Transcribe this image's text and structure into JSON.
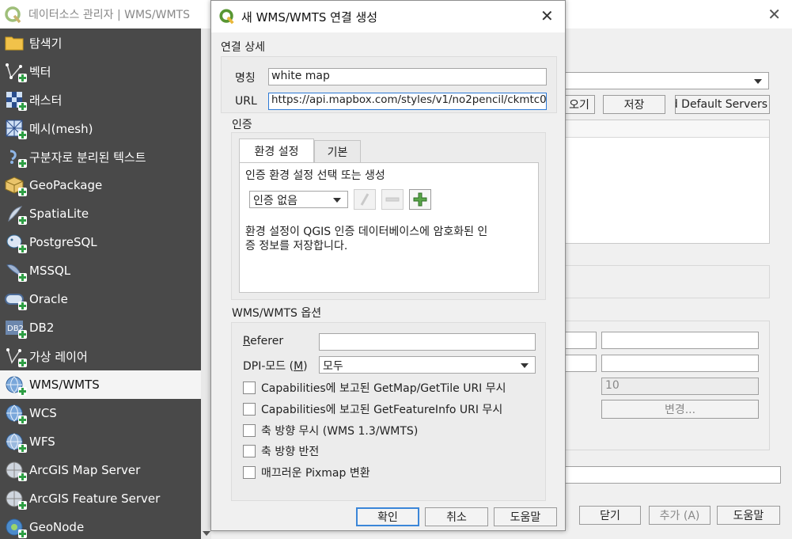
{
  "background_window": {
    "title": "데이터소스 관리자 | WMS/WMTS",
    "buttons": {
      "load_partial": "오기",
      "save": "저장",
      "add_default": "Add Default Servers",
      "close": "닫기",
      "add": "추가 (A)",
      "help": "도움말",
      "change": "변경..."
    },
    "field_values": {
      "tile_size_value": "10"
    }
  },
  "sidebar": {
    "items": [
      {
        "label": "탐색기",
        "icon": "folder-icon"
      },
      {
        "label": "벡터",
        "icon": "vector-layer-icon"
      },
      {
        "label": "래스터",
        "icon": "raster-layer-icon"
      },
      {
        "label": "메시(mesh)",
        "icon": "mesh-layer-icon"
      },
      {
        "label": "구분자로 분리된 텍스트",
        "icon": "delimited-text-icon"
      },
      {
        "label": "GeoPackage",
        "icon": "geopackage-icon"
      },
      {
        "label": "SpatiaLite",
        "icon": "spatialite-icon"
      },
      {
        "label": "PostgreSQL",
        "icon": "postgresql-icon"
      },
      {
        "label": "MSSQL",
        "icon": "mssql-icon"
      },
      {
        "label": "Oracle",
        "icon": "oracle-icon"
      },
      {
        "label": "DB2",
        "icon": "db2-icon"
      },
      {
        "label": "가상 레이어",
        "icon": "virtual-layer-icon"
      },
      {
        "label": "WMS/WMTS",
        "icon": "wms-globe-icon",
        "selected": true
      },
      {
        "label": "WCS",
        "icon": "wcs-globe-icon"
      },
      {
        "label": "WFS",
        "icon": "wfs-globe-icon"
      },
      {
        "label": "ArcGIS Map Server",
        "icon": "arcgis-map-icon"
      },
      {
        "label": "ArcGIS Feature Server",
        "icon": "arcgis-feature-icon"
      },
      {
        "label": "GeoNode",
        "icon": "geonode-icon"
      }
    ]
  },
  "dialog": {
    "title": "새 WMS/WMTS 연결 생성",
    "connection_section": "연결 상세",
    "name_label": "명칭",
    "name_value": "white map",
    "url_label": "URL",
    "url_value": "https://api.mapbox.com/styles/v1/no2pencil/ckmtc0",
    "auth_section": "인증",
    "tabs": [
      {
        "label": "환경 설정",
        "active": true
      },
      {
        "label": "기본",
        "active": false
      }
    ],
    "auth_config_label": "인증 환경 설정 선택 또는 생성",
    "auth_select_value": "인증 없음",
    "auth_info": "환경 설정이 QGIS 인증 데이터베이스에 암호화된 인증 정보를 저장합니다.",
    "auth_info_line1": "환경 설정이 QGIS 인증 데이터베이스에 암호화된 인",
    "auth_info_line2": "증 정보를 저장합니다.",
    "options_section": "WMS/WMTS 옵션",
    "referer_label": "Referer",
    "referer_value": "",
    "dpi_label_prefix": "DPI-모드 (",
    "dpi_label_key": "M",
    "dpi_label_suffix": ")",
    "dpi_value": "모두",
    "checkboxes": [
      {
        "label": "Capabilities에 보고된 GetMap/GetTile URI 무시",
        "checked": false
      },
      {
        "label": "Capabilities에 보고된 GetFeatureInfo URI 무시",
        "checked": false
      },
      {
        "label": "축 방향 무시 (WMS 1.3/WMTS)",
        "checked": false
      },
      {
        "label": "축 방향 반전",
        "checked": false
      },
      {
        "label": "매끄러운 Pixmap 변환",
        "checked": false
      }
    ],
    "buttons": {
      "ok": "확인",
      "cancel": "취소",
      "help": "도움말"
    }
  },
  "colors": {
    "sidebar_bg": "#494949",
    "qgis_green": "#589632",
    "focus_blue": "#2d7ad6"
  }
}
